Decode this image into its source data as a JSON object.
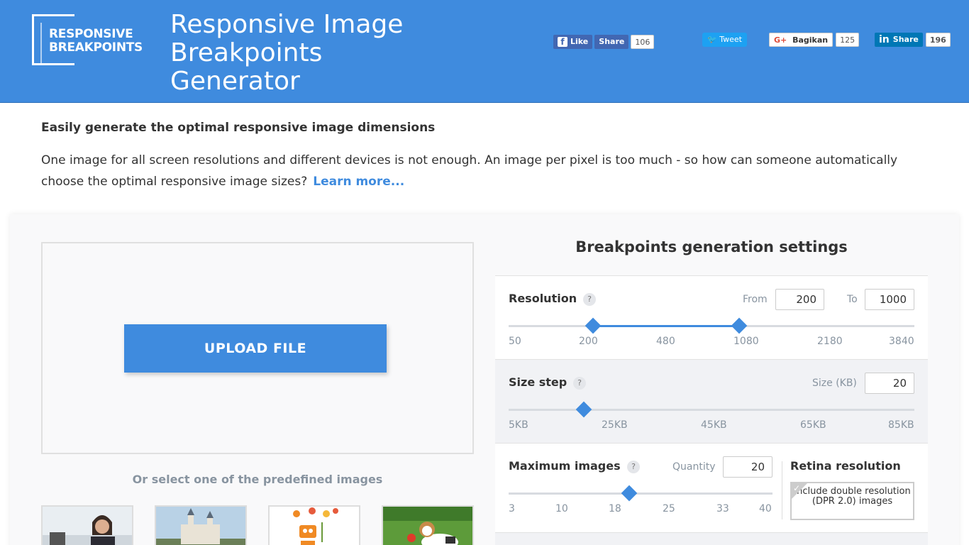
{
  "header": {
    "logo_line1": "RESPONSIVE",
    "logo_line2": "BREAKPOINTS",
    "title_line1": "Responsive Image",
    "title_line2": "Breakpoints",
    "title_line3": "Generator"
  },
  "social": {
    "facebook_like": "Like",
    "facebook_share": "Share",
    "facebook_count": "106",
    "twitter_tweet": "Tweet",
    "google_share": "Bagikan",
    "google_count": "125",
    "linkedin_share": "Share",
    "linkedin_count": "196"
  },
  "intro": {
    "heading": "Easily generate the optimal responsive image dimensions",
    "text": "One image for all screen resolutions and different devices is not enough. An image per pixel is too much - so how can someone automatically choose the optimal responsive image sizes?",
    "learn_more": "Learn more..."
  },
  "upload": {
    "button": "UPLOAD FILE",
    "predefined_label": "Or select one of the predefined images"
  },
  "settings": {
    "title": "Breakpoints generation settings",
    "resolution": {
      "label": "Resolution",
      "help": "?",
      "from_label": "From",
      "from_value": "200",
      "to_label": "To",
      "to_value": "1000",
      "ticks": [
        "50",
        "200",
        "480",
        "1080",
        "2180",
        "3840"
      ]
    },
    "size_step": {
      "label": "Size step",
      "help": "?",
      "size_label": "Size (KB)",
      "size_value": "20",
      "ticks": [
        "5KB",
        "25KB",
        "45KB",
        "65KB",
        "85KB"
      ]
    },
    "max_images": {
      "label": "Maximum images",
      "help": "?",
      "quantity_label": "Quantity",
      "quantity_value": "20",
      "ticks": [
        "3",
        "10",
        "18",
        "25",
        "33",
        "40"
      ]
    },
    "retina": {
      "label": "Retina resolution",
      "option": "Include double resolution (DPR 2.0) images",
      "checked": true
    }
  }
}
